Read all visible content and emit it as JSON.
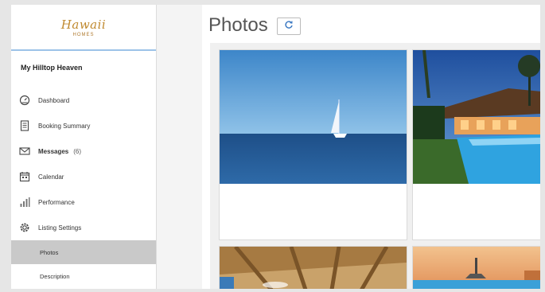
{
  "logo": {
    "script": "Hawaii",
    "sub": "HOMES"
  },
  "sidebar": {
    "property_name": "My Hilltop Heaven",
    "items": [
      {
        "label": "Dashboard",
        "icon": "dashboard-icon"
      },
      {
        "label": "Booking Summary",
        "icon": "document-icon"
      },
      {
        "label": "Messages",
        "count": "(6)",
        "icon": "envelope-icon"
      },
      {
        "label": "Calendar",
        "icon": "calendar-icon"
      },
      {
        "label": "Performance",
        "icon": "bar-chart-icon"
      },
      {
        "label": "Listing Settings",
        "icon": "gear-icon"
      }
    ],
    "sub_items": [
      {
        "label": "Photos",
        "active": true
      },
      {
        "label": "Description",
        "active": false
      }
    ]
  },
  "main": {
    "title": "Photos",
    "refresh_icon": "refresh-icon",
    "photos": [
      {
        "name": "ocean-sailboat-photo"
      },
      {
        "name": "resort-pool-photo"
      },
      {
        "name": "wooden-ceiling-interior-photo"
      },
      {
        "name": "pool-sunset-photo"
      }
    ]
  },
  "colors": {
    "logo_gold": "#c08a30",
    "logo_divider": "#9cc3e8",
    "active_sub_item_bg": "#c9c9c9"
  }
}
